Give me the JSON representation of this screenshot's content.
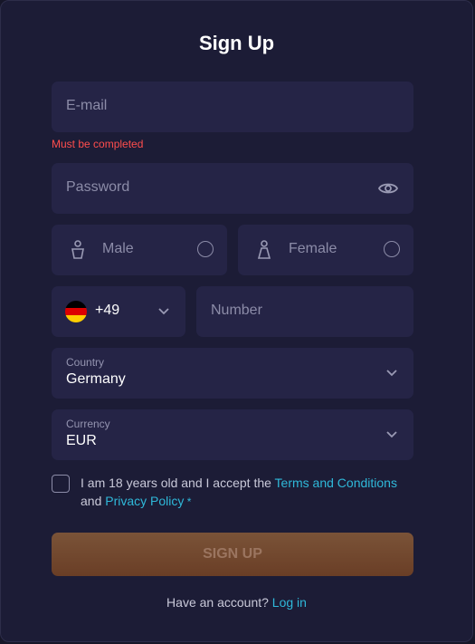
{
  "form": {
    "title": "Sign Up",
    "email_placeholder": "E-mail",
    "email_error": "Must be completed",
    "password_placeholder": "Password",
    "gender_male": "Male",
    "gender_female": "Female",
    "phone_code": "+49",
    "phone_placeholder": "Number",
    "country_label": "Country",
    "country_value": "Germany",
    "currency_label": "Currency",
    "currency_value": "EUR",
    "terms_text": "I am 18 years old and I accept the ",
    "terms_link": "Terms and Conditions",
    "terms_and": " and ",
    "privacy_link": "Privacy Policy",
    "required_mark": " *",
    "signup_label": "SIGN UP",
    "footer_text": "Have an account? ",
    "login_link": "Log in"
  },
  "colors": {
    "accent": "#2fb8d9",
    "error": "#ff4d4d",
    "button": "#6e4329",
    "background": "#1c1c36",
    "field": "#252446"
  },
  "icons": [
    "eye-icon",
    "male-icon",
    "female-icon",
    "germany-flag-icon",
    "chevron-down-icon"
  ]
}
